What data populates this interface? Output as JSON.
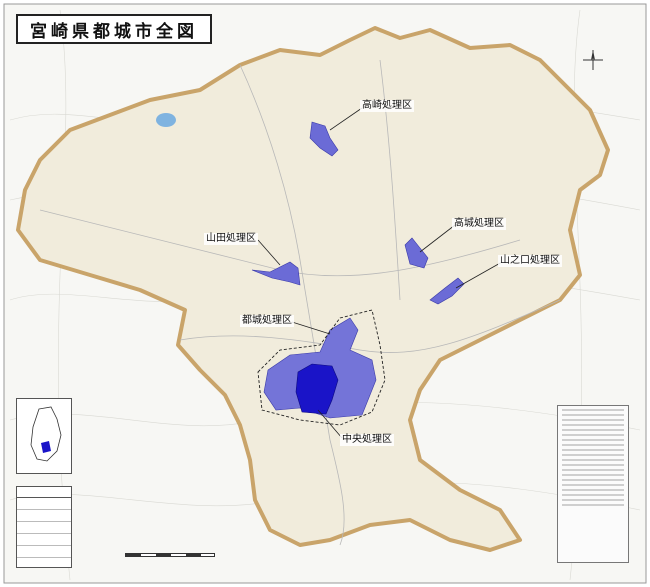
{
  "map": {
    "title": "宮崎県都城市全図",
    "districts": [
      {
        "id": "takasaki",
        "name": "高崎処理区"
      },
      {
        "id": "takajo",
        "name": "高城処理区"
      },
      {
        "id": "yamada",
        "name": "山田処理区"
      },
      {
        "id": "yamanokuchi",
        "name": "山之口処理区"
      },
      {
        "id": "miyakonojo",
        "name": "都城処理区"
      },
      {
        "id": "chuo",
        "name": "中央処理区"
      }
    ],
    "colors": {
      "city_boundary": "#c9a46a",
      "land": "#f3efe4",
      "treatment_area": "#6b6bd6",
      "central_core": "#1a14c8",
      "water": "#7fb3e0"
    }
  }
}
